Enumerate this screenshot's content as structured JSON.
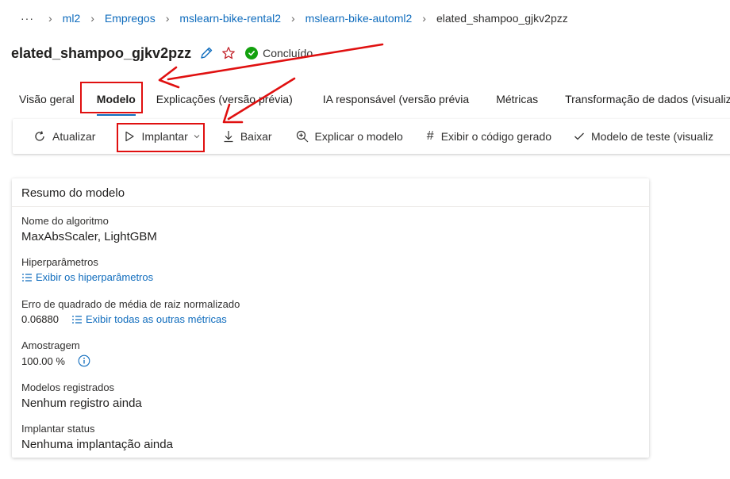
{
  "breadcrumb": {
    "more": "···",
    "items": [
      "ml2",
      "Empregos",
      "mslearn-bike-rental2",
      "mslearn-bike-automl2"
    ],
    "current": "elated_shampoo_gjkv2pzz"
  },
  "header": {
    "title": "elated_shampoo_gjkv2pzz",
    "status": "Concluído"
  },
  "tabs": [
    "Visão geral",
    "Modelo",
    "Explicações (versão prévia)",
    "IA responsável (versão prévia",
    "Métricas",
    "Transformação de dados (visualiza"
  ],
  "active_tab": "Modelo",
  "toolbar": {
    "refresh": "Atualizar",
    "deploy": "Implantar",
    "download": "Baixar",
    "explain": "Explicar o modelo",
    "view_code": "Exibir o código gerado",
    "test_model": "Modelo de teste (visualiz"
  },
  "summary": {
    "title": "Resumo do modelo",
    "algorithm_label": "Nome do algoritmo",
    "algorithm_value": "MaxAbsScaler, LightGBM",
    "hyper_label": "Hiperparâmetros",
    "hyper_link": "Exibir os hiperparâmetros",
    "metric_label": "Erro de quadrado de média de raiz normalizado",
    "metric_value": "0.06880",
    "metric_link": "Exibir todas as outras métricas",
    "sampling_label": "Amostragem",
    "sampling_value": "100.00 %",
    "registered_label": "Modelos registrados",
    "registered_value": "Nenhum registro ainda",
    "deploy_status_label": "Implantar status",
    "deploy_status_value": "Nenhuma implantação ainda"
  },
  "colors": {
    "link": "#0f6cbd",
    "success": "#13a10e",
    "annotation": "#e01010",
    "favorite": "#c4262e"
  }
}
